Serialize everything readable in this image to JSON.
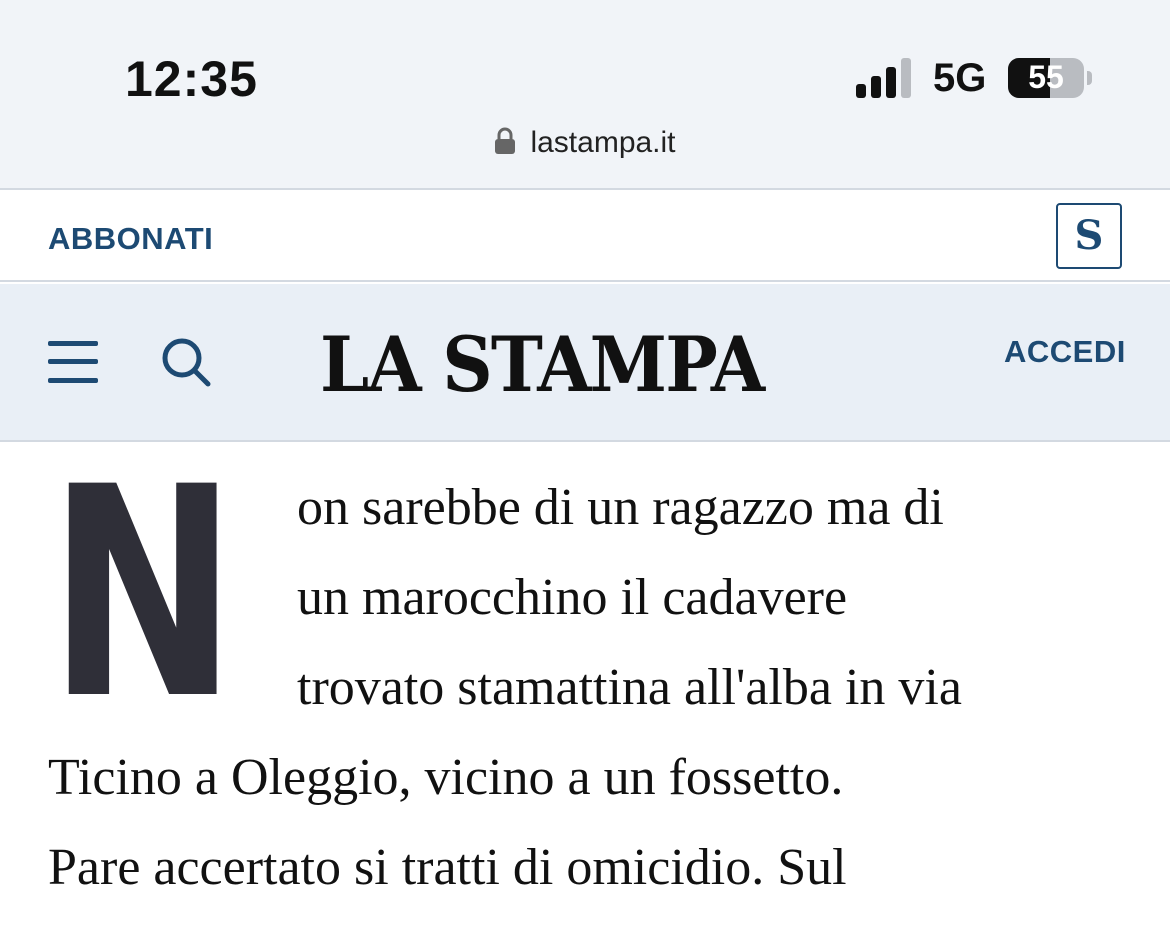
{
  "status_bar": {
    "time": "12:35",
    "network": "5G",
    "battery_level": "55",
    "battery_fraction": 0.55,
    "signal_bars_active": 3,
    "signal_bars_total": 4
  },
  "address_bar": {
    "url": "lastampa.it"
  },
  "subscribe_bar": {
    "subscribe_label": "ABBONATI",
    "badge_letter": "S"
  },
  "header": {
    "logo_text": "LA STAMPA",
    "login_label": "ACCEDI"
  },
  "article": {
    "drop_cap": "N",
    "lines": [
      "on sarebbe di un ragazzo ma di",
      "un marocchino il cadavere",
      "trovato stamattina all'alba in via",
      "Ticino a Oleggio, vicino a un fossetto.",
      "Pare accertato si tratti di omicidio. Sul"
    ]
  },
  "colors": {
    "brand_blue": "#1d4a73",
    "status_bg": "#f1f4f8",
    "masthead_bg": "#e9eff6",
    "dropcap": "#2f2f38"
  },
  "icons": [
    "lock-icon",
    "signal-icon",
    "battery-icon",
    "menu-icon",
    "search-icon"
  ]
}
